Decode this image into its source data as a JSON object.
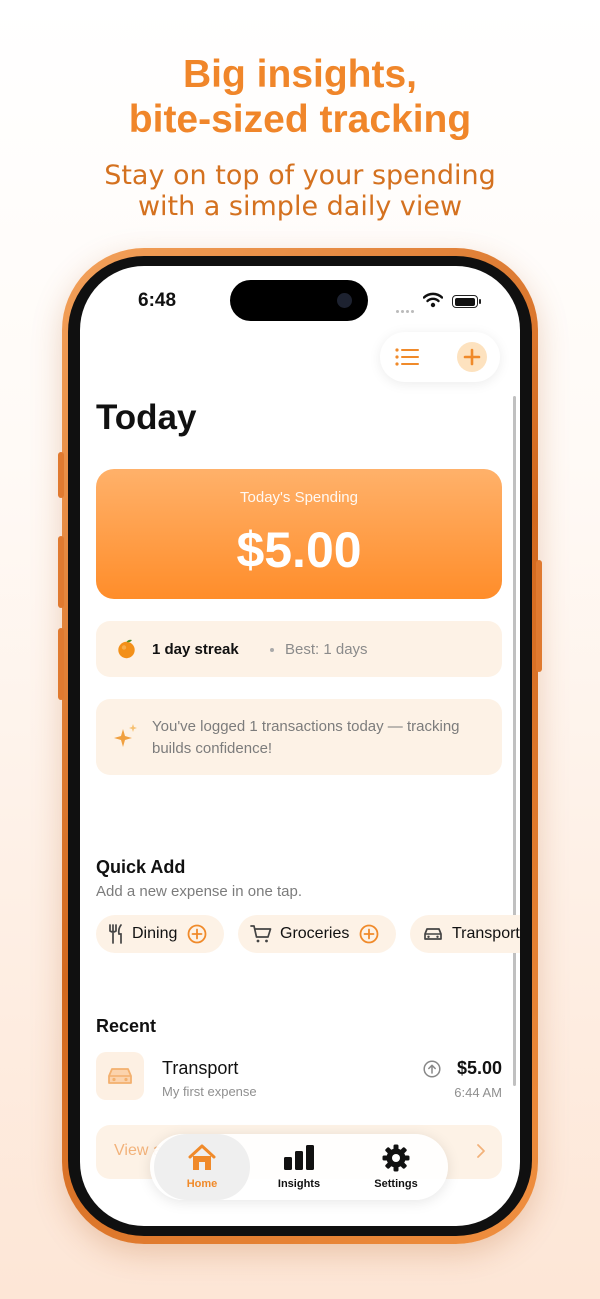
{
  "promo": {
    "headline_line1": "Big insights,",
    "headline_line2": "bite-sized tracking",
    "subline_line1": "Stay on top of your spending",
    "subline_line2": "with a simple daily view"
  },
  "status_bar": {
    "time": "6:48"
  },
  "toolbar": {
    "list_icon": "list-icon",
    "add_icon": "plus-icon"
  },
  "page": {
    "title": "Today"
  },
  "spending_card": {
    "label": "Today's Spending",
    "value": "$5.00"
  },
  "streak": {
    "text": "1 day streak",
    "best": "Best: 1 days",
    "icon": "orange-fruit-icon"
  },
  "tip": {
    "text": "You've logged 1 transactions today — tracking builds confidence!",
    "icon": "sparkles-icon"
  },
  "quick_add": {
    "title": "Quick Add",
    "subtitle": "Add a new expense in one tap.",
    "chips": [
      {
        "label": "Dining",
        "icon": "fork-knife-icon"
      },
      {
        "label": "Groceries",
        "icon": "cart-icon"
      },
      {
        "label": "Transport",
        "icon": "car-icon"
      }
    ]
  },
  "recent": {
    "title": "Recent",
    "items": [
      {
        "name": "Transport",
        "note": "My first expense",
        "amount": "$5.00",
        "time": "6:44 AM",
        "icon": "car-icon"
      }
    ],
    "view_all_label": "View all"
  },
  "tab_bar": {
    "tabs": [
      {
        "label": "Home",
        "icon": "house-icon",
        "active": true
      },
      {
        "label": "Insights",
        "icon": "bar-chart-icon",
        "active": false
      },
      {
        "label": "Settings",
        "icon": "gear-icon",
        "active": false
      }
    ]
  },
  "colors": {
    "accent": "#FF8D2A",
    "card_bg": "#FDF2E6",
    "frame": "#E07A30"
  }
}
